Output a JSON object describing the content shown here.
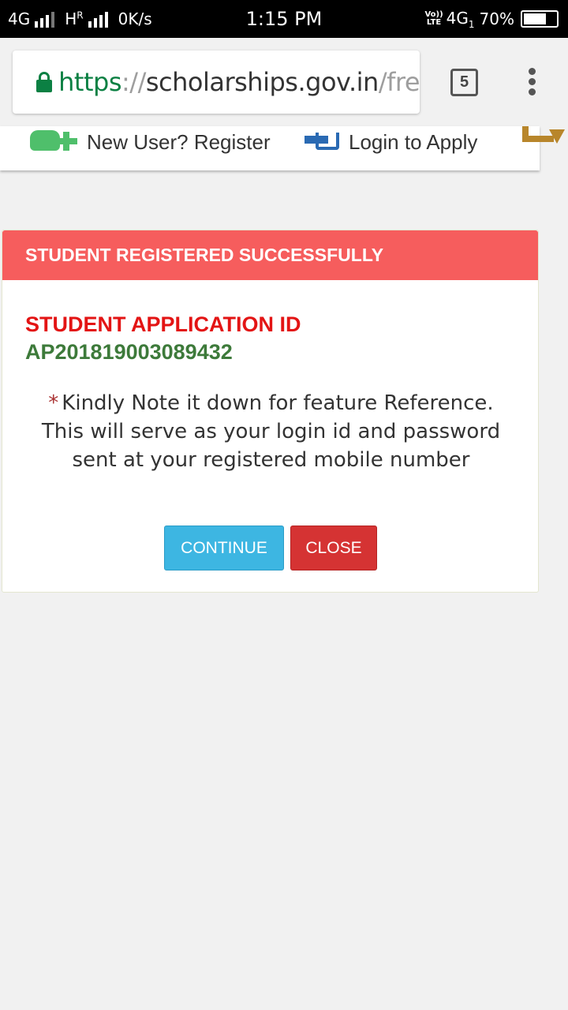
{
  "status_bar": {
    "network_1": "4G",
    "network_2": "H",
    "network_2_sup": "R",
    "speed": "0K/s",
    "time": "1:15 PM",
    "volte_top": "Vo))",
    "volte_bottom": "LTE",
    "network_3": "4G",
    "network_3_sub": "1",
    "battery": "70%",
    "battery_level": 0.7
  },
  "browser": {
    "url_scheme": "https",
    "url_sep": "://",
    "url_host": "scholarships.gov.in",
    "url_path": "/fre",
    "tab_count": "5",
    "accent": "#0b8043"
  },
  "nav": {
    "register_label": "New User? Register",
    "login_label": "Login to Apply"
  },
  "modal": {
    "title": "STUDENT REGISTERED SUCCESSFULLY",
    "app_id_label": "STUDENT APPLICATION ID",
    "app_id_value": "AP201819003089432",
    "asterisk": "*",
    "note_line1": "Kindly Note it down for feature Reference.",
    "note_line2": "This will serve as your login id and password",
    "note_line3": "sent at your registered mobile number",
    "continue_label": "CONTINUE",
    "close_label": "CLOSE",
    "header_color": "#f65d5d",
    "continue_color": "#3db6e2",
    "close_color": "#d53333"
  },
  "icons": [
    "lock-icon",
    "menu-icon",
    "user-add-icon",
    "login-icon",
    "more-icon"
  ]
}
